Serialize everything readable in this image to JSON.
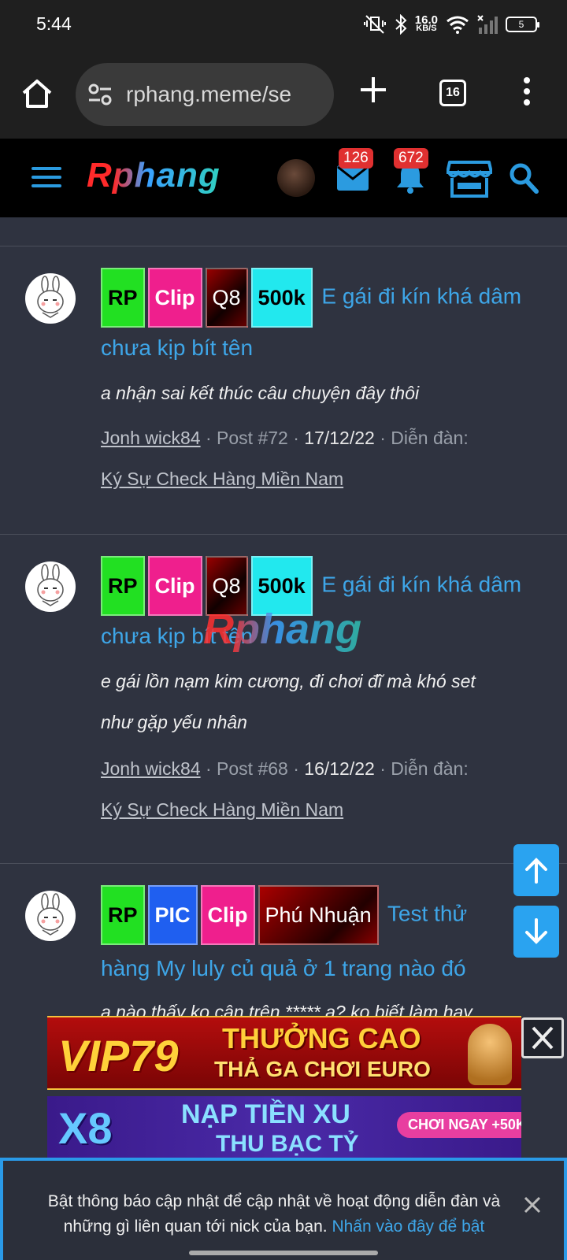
{
  "status_bar": {
    "time": "5:44",
    "speed_value": "16.0",
    "speed_unit": "KB/S",
    "battery": "5"
  },
  "browser": {
    "url": "rphang.meme/se",
    "tab_count": "16"
  },
  "site": {
    "logo": "Rphang",
    "mail_count": "126",
    "notification_count": "672"
  },
  "posts": [
    {
      "tags": [
        "RP",
        "Clip",
        "Q8",
        "500k"
      ],
      "title_line1": "E gái đi kín khá dâm",
      "title_line2": "chưa kịp bít tên",
      "snippet_line1": "a nhận sai kết thúc câu chuyện đây thôi",
      "snippet_line2": "",
      "author": "Jonh wick84",
      "post_no": "Post #72",
      "date": "17/12/22",
      "forum_label": "Diễn đàn:",
      "forum": "Ký Sự Check Hàng Miền Nam"
    },
    {
      "tags": [
        "RP",
        "Clip",
        "Q8",
        "500k"
      ],
      "title_line1": "E gái đi kín khá dâm",
      "title_line2": "chưa kịp bít tên",
      "snippet_line1": "e gái lồn nạm kim cương, đi chơi đĩ mà khó set",
      "snippet_line2": "như gặp yếu nhân",
      "author": "Jonh wick84",
      "post_no": "Post #68",
      "date": "16/12/22",
      "forum_label": "Diễn đàn:",
      "forum": "Ký Sự Check Hàng Miền Nam"
    },
    {
      "tags": [
        "RP",
        "PIC",
        "Clip",
        "Phú Nhuận"
      ],
      "title_line1": "Test thử",
      "title_line2": "hàng My luly củ quả ở 1 trang nào đó",
      "snippet_line1": "a nào thấy ko cân trên ***** ạ? ko biết làm hay",
      "author": "",
      "post_no": "",
      "date": "",
      "forum_label": "",
      "forum": ""
    }
  ],
  "watermark": "Rphang",
  "ads": {
    "vip": {
      "brand": "VIP79",
      "line1": "THƯỞNG CAO",
      "line2": "THẢ GA CHƠI EURO"
    },
    "x8": {
      "brand": "X8",
      "line1": "NẠP TIỀN XU",
      "line2": "THU BẠC TỶ",
      "cta": "CHƠI NGAY +50K"
    }
  },
  "notification": {
    "message": "Bật thông báo cập nhật để cập nhật về hoạt động diễn đàn và những gì liên quan tới nick của bạn.",
    "link": "Nhấn vào đây để bật"
  },
  "colors": {
    "accent": "#2aa3f0",
    "link": "#3ea6e8",
    "badge": "#e03030",
    "background": "#2f3340"
  }
}
